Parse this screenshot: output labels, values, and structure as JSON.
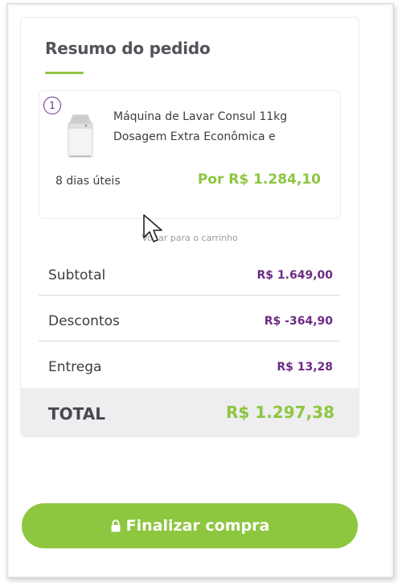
{
  "summary": {
    "title": "Resumo do pedido",
    "item": {
      "quantity": "1",
      "name": "Máquina de Lavar Consul 11kg Dosagem Extra Econômica e",
      "delivery": "8 dias úteis",
      "price": "Por R$ 1.284,10",
      "image_icon": "washing-machine-icon"
    },
    "back_link": "Voltar para o carrinho",
    "rows": [
      {
        "label": "Subtotal",
        "value": "R$ 1.649,00"
      },
      {
        "label": "Descontos",
        "value": "R$ -364,90"
      },
      {
        "label": "Entrega",
        "value": "R$ 13,28"
      }
    ],
    "total": {
      "label": "TOTAL",
      "value": "R$ 1.297,38"
    }
  },
  "checkout": {
    "label": "Finalizar compra",
    "icon": "lock-icon"
  },
  "colors": {
    "accent_green": "#8dc63f",
    "purple": "#6b2c83",
    "text": "#3f3b43"
  }
}
